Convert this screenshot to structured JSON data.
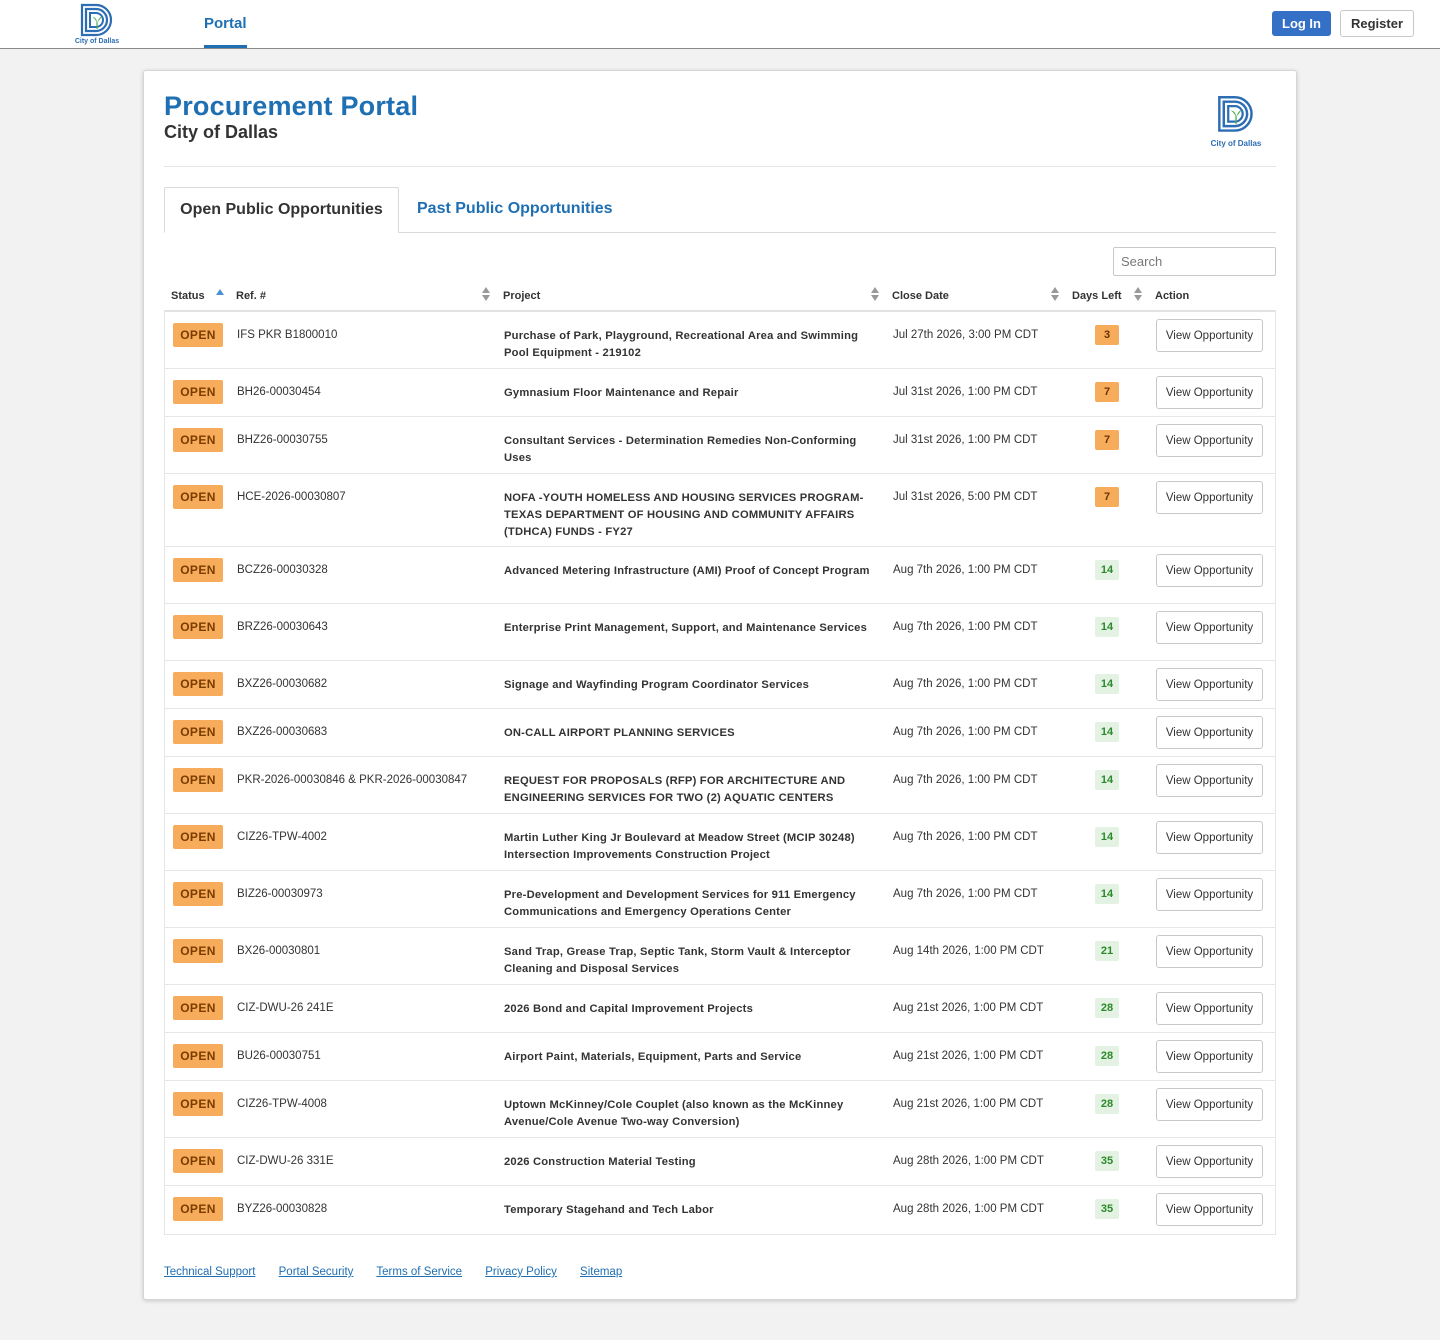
{
  "nav": {
    "logo_text": "City of Dallas",
    "portal_label": "Portal",
    "login_label": "Log In",
    "register_label": "Register"
  },
  "header": {
    "title": "Procurement Portal",
    "subtitle": "City of Dallas",
    "logo_text": "City of Dallas"
  },
  "tabs": {
    "open_label": "Open Public Opportunities",
    "past_label": "Past Public Opportunities"
  },
  "search": {
    "placeholder": "Search"
  },
  "table": {
    "headers": {
      "status": "Status",
      "ref": "Ref. #",
      "project": "Project",
      "close_date": "Close Date",
      "days_left": "Days Left",
      "action": "Action"
    },
    "rows": [
      {
        "status": "OPEN",
        "ref": "IFS PKR B1800010",
        "project": "Purchase of Park, Playground, Recreational Area and Swimming Pool Equipment - 219102",
        "close": "Jul 27th 2026, 3:00 PM CDT",
        "days": "3",
        "urgent": true,
        "action": "View Opportunity"
      },
      {
        "status": "OPEN",
        "ref": "BH26-00030454",
        "project": "Gymnasium Floor Maintenance and Repair",
        "close": "Jul 31st 2026, 1:00 PM CDT",
        "days": "7",
        "urgent": true,
        "action": "View Opportunity"
      },
      {
        "status": "OPEN",
        "ref": "BHZ26-00030755",
        "project": "Consultant Services - Determination Remedies Non-Conforming Uses",
        "close": "Jul 31st 2026, 1:00 PM CDT",
        "days": "7",
        "urgent": true,
        "action": "View Opportunity"
      },
      {
        "status": "OPEN",
        "ref": "HCE-2026-00030807",
        "project": "NOFA -YOUTH HOMELESS AND HOUSING SERVICES PROGRAM- TEXAS DEPARTMENT OF HOUSING AND COMMUNITY AFFAIRS (TDHCA) FUNDS - FY27",
        "close": "Jul 31st 2026, 5:00 PM CDT",
        "days": "7",
        "urgent": true,
        "action": "View Opportunity"
      },
      {
        "status": "OPEN",
        "ref": "BCZ26-00030328",
        "project": "Advanced Metering Infrastructure (AMI) Proof of Concept Program",
        "close": "Aug 7th 2026, 1:00 PM CDT",
        "days": "14",
        "urgent": false,
        "action": "View Opportunity"
      },
      {
        "status": "OPEN",
        "ref": "BRZ26-00030643",
        "project": "Enterprise Print Management, Support, and Maintenance Services",
        "close": "Aug 7th 2026, 1:00 PM CDT",
        "days": "14",
        "urgent": false,
        "action": "View Opportunity"
      },
      {
        "status": "OPEN",
        "ref": "BXZ26-00030682",
        "project": "Signage and Wayfinding Program Coordinator Services",
        "close": "Aug 7th 2026, 1:00 PM CDT",
        "days": "14",
        "urgent": false,
        "action": "View Opportunity"
      },
      {
        "status": "OPEN",
        "ref": "BXZ26-00030683",
        "project": "ON-CALL AIRPORT PLANNING SERVICES",
        "close": "Aug 7th 2026, 1:00 PM CDT",
        "days": "14",
        "urgent": false,
        "action": "View Opportunity"
      },
      {
        "status": "OPEN",
        "ref": "PKR-2026-00030846 & PKR-2026-00030847",
        "project": "REQUEST FOR PROPOSALS (RFP) FOR ARCHITECTURE AND ENGINEERING SERVICES FOR TWO (2) AQUATIC CENTERS",
        "close": "Aug 7th 2026, 1:00 PM CDT",
        "days": "14",
        "urgent": false,
        "action": "View Opportunity"
      },
      {
        "status": "OPEN",
        "ref": "CIZ26-TPW-4002",
        "project": "Martin Luther King Jr Boulevard at Meadow Street (MCIP 30248) Intersection Improvements Construction Project",
        "close": "Aug 7th 2026, 1:00 PM CDT",
        "days": "14",
        "urgent": false,
        "action": "View Opportunity"
      },
      {
        "status": "OPEN",
        "ref": "BIZ26-00030973",
        "project": "Pre-Development and Development Services for 911 Emergency Communications and Emergency Operations Center",
        "close": "Aug 7th 2026, 1:00 PM CDT",
        "days": "14",
        "urgent": false,
        "action": "View Opportunity"
      },
      {
        "status": "OPEN",
        "ref": "BX26-00030801",
        "project": "Sand Trap, Grease Trap, Septic Tank, Storm Vault & Interceptor Cleaning and Disposal Services",
        "close": "Aug 14th 2026, 1:00 PM CDT",
        "days": "21",
        "urgent": false,
        "action": "View Opportunity"
      },
      {
        "status": "OPEN",
        "ref": "CIZ-DWU-26 241E",
        "project": "2026 Bond and Capital Improvement Projects",
        "close": "Aug 21st 2026, 1:00 PM CDT",
        "days": "28",
        "urgent": false,
        "action": "View Opportunity"
      },
      {
        "status": "OPEN",
        "ref": "BU26-00030751",
        "project": "Airport Paint, Materials, Equipment, Parts and Service",
        "close": "Aug 21st 2026, 1:00 PM CDT",
        "days": "28",
        "urgent": false,
        "action": "View Opportunity"
      },
      {
        "status": "OPEN",
        "ref": "CIZ26-TPW-4008",
        "project": "Uptown McKinney/Cole Couplet (also known as the McKinney Avenue/Cole Avenue Two-way Conversion)",
        "close": "Aug 21st 2026, 1:00 PM CDT",
        "days": "28",
        "urgent": false,
        "action": "View Opportunity"
      },
      {
        "status": "OPEN",
        "ref": "CIZ-DWU-26 331E",
        "project": "2026 Construction Material Testing",
        "close": "Aug 28th 2026, 1:00 PM CDT",
        "days": "35",
        "urgent": false,
        "action": "View Opportunity"
      },
      {
        "status": "OPEN",
        "ref": "BYZ26-00030828",
        "project": "Temporary Stagehand and Tech Labor",
        "close": "Aug 28th 2026, 1:00 PM CDT",
        "days": "35",
        "urgent": false,
        "action": "View Opportunity"
      }
    ]
  },
  "footer": {
    "links": [
      "Technical Support",
      "Portal Security",
      "Terms of Service",
      "Privacy Policy",
      "Sitemap"
    ]
  },
  "colors": {
    "brand_blue": "#1f6fb3",
    "login_blue": "#3470c6",
    "open_orange": "#f7ac5c",
    "days_green_bg": "#e3f2e3",
    "days_green_text": "#2a8a2a"
  }
}
